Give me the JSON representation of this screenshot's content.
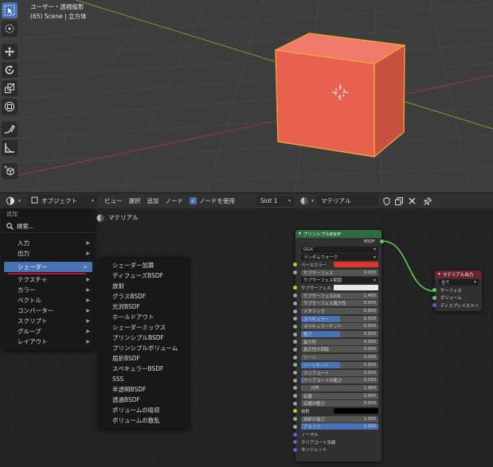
{
  "viewport": {
    "info_line1": "ユーザー・透視投影",
    "info_line2": "(65) Scene | 立方体",
    "tools": [
      "select-box-icon",
      "cursor-icon",
      "move-icon",
      "rotate-icon",
      "scale-icon",
      "transform-icon",
      "annotate-icon",
      "measure-icon",
      "add-cube-icon"
    ],
    "cube_color": "#e8604f",
    "selection_outline": "#f2a23a"
  },
  "node_header": {
    "mode": "オブジェクト",
    "view": "ビュー",
    "select": "選択",
    "add": "追加",
    "node": "ノード",
    "use_nodes": "ノードを使用",
    "slot": "Slot 1",
    "material_name": "マテリアル"
  },
  "node_editor": {
    "breadcrumb": "マテリアル"
  },
  "add_menu": {
    "title": "追加",
    "search": "検索...",
    "items": [
      "入力",
      "出力",
      "シェーダー",
      "テクスチャ",
      "カラー",
      "ベクトル",
      "コンバーター",
      "スクリプト",
      "グループ",
      "レイアウト"
    ],
    "active_index": 2
  },
  "shader_menu": {
    "items": [
      "シェーダー加算",
      "ディフューズBSDF",
      "放射",
      "グラスBSDF",
      "光沢BSDF",
      "ホールドアウト",
      "シェーダーミックス",
      "プリンシプルBSDF",
      "プリンシプルボリューム",
      "屈折BSDF",
      "スペキュラーBSDF",
      "SSS",
      "半透明BSDF",
      "透過BSDF",
      "ボリュームの吸収",
      "ボリュームの散乱"
    ],
    "underlined_index": 7
  },
  "bsdf_node": {
    "title": "プリンシプルBSDF",
    "output": "BSDF",
    "distribution": "GGX",
    "subsurface_method": "ランダムウォーク",
    "base_color_label": "ベースカラー",
    "base_color": "#e0352b",
    "rows": [
      {
        "label": "サブサーフェス",
        "value": "0.000",
        "fill": 0
      },
      {
        "label": "サブサーフェス範囲",
        "value": "",
        "fill": 0,
        "drop": true
      },
      {
        "label": "サブサーフェス...",
        "value": "",
        "fill": 0,
        "swatch": "#e8e8e8"
      },
      {
        "label": "サブサーフェスIOR",
        "value": "1.400",
        "fill": 0
      },
      {
        "label": "サブサーフェス異方性",
        "value": "0.000",
        "fill": 0
      },
      {
        "label": "メタリック",
        "value": "0.000",
        "fill": 0
      },
      {
        "label": "スペキュラー",
        "value": "0.500",
        "fill": 0.5
      },
      {
        "label": "スペキュラーチント",
        "value": "0.000",
        "fill": 0
      },
      {
        "label": "粗さ",
        "value": "0.500",
        "fill": 0.5
      },
      {
        "label": "異方性",
        "value": "0.000",
        "fill": 0
      },
      {
        "label": "異方性の回転",
        "value": "0.000",
        "fill": 0
      },
      {
        "label": "シーン",
        "value": "0.000",
        "fill": 0
      },
      {
        "label": "シーンチント",
        "value": "0.500",
        "fill": 0.5
      },
      {
        "label": "クリアコート",
        "value": "0.000",
        "fill": 0
      },
      {
        "label": "クリアコートの粗さ",
        "value": "0.030",
        "fill": 0.03
      },
      {
        "label": "IOR",
        "value": "1.450",
        "fill": 0,
        "center": true
      },
      {
        "label": "伝播",
        "value": "0.000",
        "fill": 0
      },
      {
        "label": "伝播の粗さ",
        "value": "0.000",
        "fill": 0
      }
    ],
    "emission_label": "放射",
    "emission_color": "#000000",
    "emission_strength_label": "放射の強さ",
    "emission_strength": "1.000",
    "alpha_label": "アルファ",
    "alpha": "1.000",
    "normal": "ノーマル",
    "clearcoat_normal": "クリアコート法線",
    "tangent": "タンジェント"
  },
  "output_node": {
    "title": "マテリアル出力",
    "target": "全て",
    "surface": "サーフェス",
    "volume": "ボリューム",
    "displacement": "ディスプレイスメント"
  }
}
